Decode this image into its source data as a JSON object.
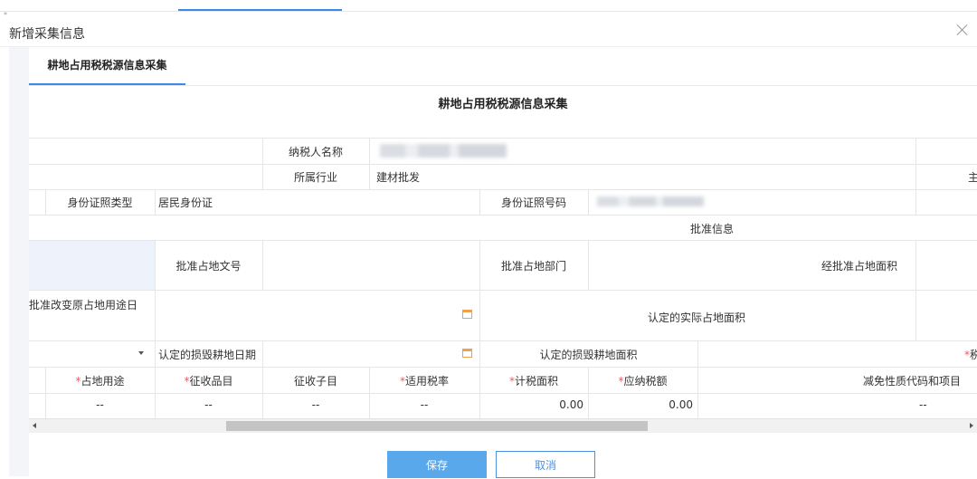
{
  "dialog": {
    "title": "新增采集信息",
    "corner_mark": "*"
  },
  "tabs": [
    {
      "label": "耕地占用税税源信息采集",
      "active": true
    }
  ],
  "form": {
    "title": "耕地占用税税源信息采集",
    "taxpayer_name_label": "纳税人名称",
    "taxpayer_name_value": "",
    "industry_label": "所属行业",
    "industry_value": "建材批发",
    "truncated_right_label": "主",
    "id_type_label": "身份证照类型",
    "id_type_value": "居民身份证",
    "id_number_label": "身份证照号码",
    "approval_section_label": "批准信息",
    "approval_doc_label": "批准占地文号",
    "approval_dept_label": "批准占地部门",
    "approved_area_label": "经批准占地面积",
    "change_use_date_label": "批准改变原占地用途日",
    "actual_area_label": "认定的实际占地面积",
    "damage_date_label": "认定的损毁耕地日期",
    "damage_area_label": "认定的损毁耕地面积",
    "truncated_required_label": "税",
    "table_headers": [
      {
        "label": "占地用途",
        "required": true
      },
      {
        "label": "征收品目",
        "required": true
      },
      {
        "label": "征收子目",
        "required": false
      },
      {
        "label": "适用税率",
        "required": true
      },
      {
        "label": "计税面积",
        "required": true
      },
      {
        "label": "应纳税额",
        "required": true
      },
      {
        "label": "减免性质代码和项目",
        "required": false
      }
    ],
    "table_row": [
      "--",
      "--",
      "--",
      "--",
      "0.00",
      "0.00",
      "--"
    ]
  },
  "buttons": {
    "save": "保存",
    "cancel": "取消"
  },
  "colors": {
    "accent": "#3b8ae6",
    "save_button": "#5aa8ec",
    "required_star": "#f0595d",
    "calendar_icon": "#f0a24a"
  }
}
